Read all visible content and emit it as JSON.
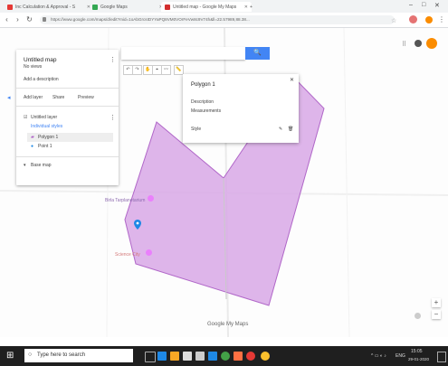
{
  "browser": {
    "tabs": [
      {
        "label": "Inc Calculation & Approval - S",
        "color": "#e53935"
      },
      {
        "label": "Google Maps",
        "color": "#34a853"
      },
      {
        "label": "Untitled map - Google My Maps",
        "color": "#d32f2f"
      }
    ],
    "new_tab_label": "+",
    "window_controls": {
      "minimize": "–",
      "maximize": "□",
      "close": "✕"
    },
    "url": "https://www.google.com/maps/d/edit?mid=1oAbGrcsIDYYaPQ8VM0VOrFeVw8c9V74h&ll=22.57989,88.38...",
    "nav": {
      "back": "‹",
      "forward": "›",
      "reload": "↻"
    }
  },
  "left_panel": {
    "title": "Untitled map",
    "subtitle": "No views",
    "description": "Add a description",
    "actions": [
      "Add layer",
      "Share",
      "Preview"
    ],
    "layer_name": "Untitled layer",
    "layer_style": "Individual styles",
    "items": [
      "Polygon 1",
      "Point 1"
    ],
    "base_map": "Base map"
  },
  "search": {
    "placeholder": "",
    "button_icon": "🔍"
  },
  "toolbar": [
    "↶",
    "↷",
    "✋",
    "⌖",
    "〰",
    "📏"
  ],
  "popup": {
    "title": "Polygon 1",
    "description": "Description",
    "meta": "Measurements",
    "footer_left": "Style",
    "footer_icons": [
      "✎",
      "🗑"
    ]
  },
  "map_labels": {
    "place1": "Birla Tarplanetarium",
    "place2": "Science City",
    "brand": "Google My Maps"
  },
  "zoom": {
    "in": "+",
    "out": "−"
  },
  "taskbar": {
    "search_placeholder": "Type here to search",
    "time": "15:05",
    "date": "29-01-2020",
    "lang": "ENG"
  },
  "colors": {
    "polygon_fill": "#d8a8e6",
    "polygon_stroke": "#b066c8",
    "accent": "#4285f4",
    "pin": "#1e88e5",
    "place_pin": "#ea80fc"
  }
}
